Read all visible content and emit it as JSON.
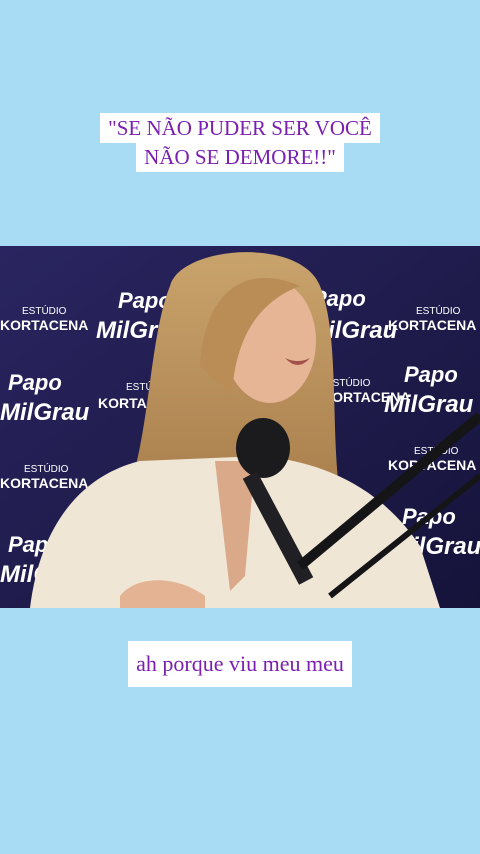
{
  "caption_top": {
    "line1": "\"SE NÃO PUDER SER VOCÊ",
    "line2": "NÃO SE DEMORE!!\""
  },
  "caption_bottom": {
    "text": "ah porque viu meu meu"
  },
  "backdrop": {
    "estudio": "ESTÚDIO",
    "kortacena": "KORTACENA",
    "papo": "Papo",
    "milgrau": "MilGrau"
  },
  "colors": {
    "page_background": "#a8dcf5",
    "caption_text": "#7a1fb0",
    "caption_background": "#ffffff",
    "backdrop": "#1f1c4a"
  }
}
